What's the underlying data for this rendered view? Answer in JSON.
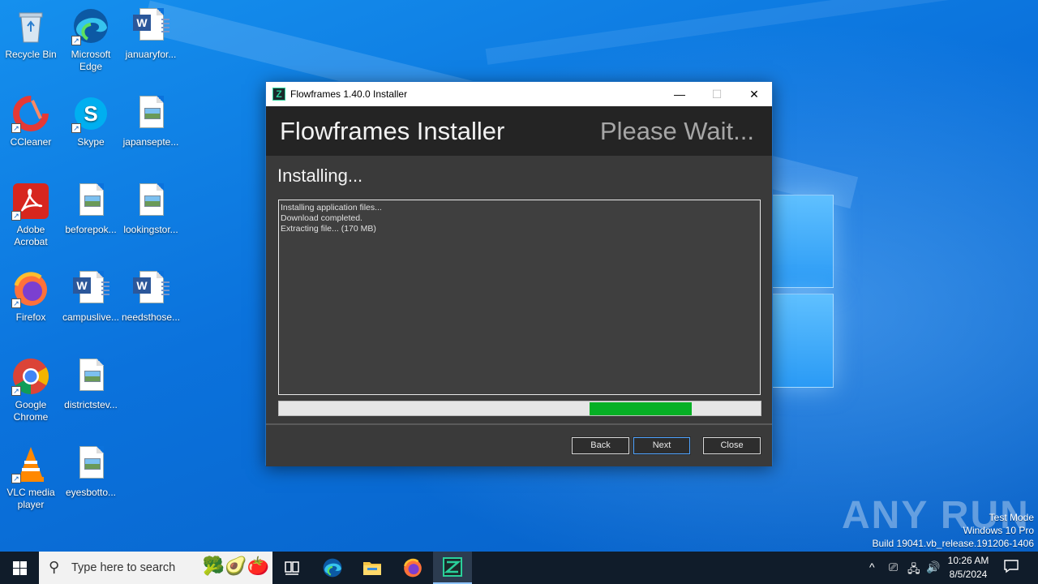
{
  "desktop": {
    "icons": [
      {
        "label": "Recycle Bin",
        "icon": "recycle-bin-icon"
      },
      {
        "label": "Microsoft Edge",
        "icon": "edge-icon"
      },
      {
        "label": "januaryfor...",
        "icon": "word-doc-icon"
      },
      {
        "label": "CCleaner",
        "icon": "ccleaner-icon"
      },
      {
        "label": "Skype",
        "icon": "skype-icon"
      },
      {
        "label": "japansepte...",
        "icon": "image-file-icon"
      },
      {
        "label": "Adobe Acrobat",
        "icon": "acrobat-icon"
      },
      {
        "label": "beforepok...",
        "icon": "image-file-icon"
      },
      {
        "label": "lookingstor...",
        "icon": "image-file-icon"
      },
      {
        "label": "Firefox",
        "icon": "firefox-icon"
      },
      {
        "label": "campuslive...",
        "icon": "word-doc-icon"
      },
      {
        "label": "needsthose...",
        "icon": "word-doc-icon"
      },
      {
        "label": "Google Chrome",
        "icon": "chrome-icon"
      },
      {
        "label": "districtstev...",
        "icon": "image-file-icon"
      },
      {
        "label": "VLC media player",
        "icon": "vlc-icon"
      },
      {
        "label": "eyesbotto...",
        "icon": "image-file-icon"
      }
    ]
  },
  "installer": {
    "window_title": "Flowframes 1.40.0 Installer",
    "header_title": "Flowframes Installer",
    "header_status": "Please Wait...",
    "step_label": "Installing...",
    "log_lines": [
      "Installing application files...",
      "Download completed.",
      "Extracting file... (170 MB)"
    ],
    "progress": {
      "segment_start_fraction": 0.645,
      "segment_end_fraction": 0.857,
      "color": "#06b025"
    },
    "buttons": {
      "back": "Back",
      "next": "Next",
      "close": "Close"
    },
    "title_controls": {
      "minimize": "—",
      "maximize": "☐",
      "close": "✕"
    }
  },
  "watermark": {
    "text": "ANY RUN",
    "lines": [
      "Test Mode",
      "Windows 10 Pro",
      "Build 19041.vb_release.191206-1406"
    ]
  },
  "taskbar": {
    "search_placeholder": "Type here to search",
    "clock_time": "10:26 AM",
    "clock_date": "8/5/2024",
    "apps": [
      "task-view-icon",
      "edge-icon",
      "file-explorer-icon",
      "firefox-icon",
      "flowframes-icon"
    ]
  },
  "colors": {
    "accent": "#1f6fbf",
    "window_bg": "#3a3a3a",
    "header_bg": "#242424",
    "progress_green": "#06b025"
  }
}
